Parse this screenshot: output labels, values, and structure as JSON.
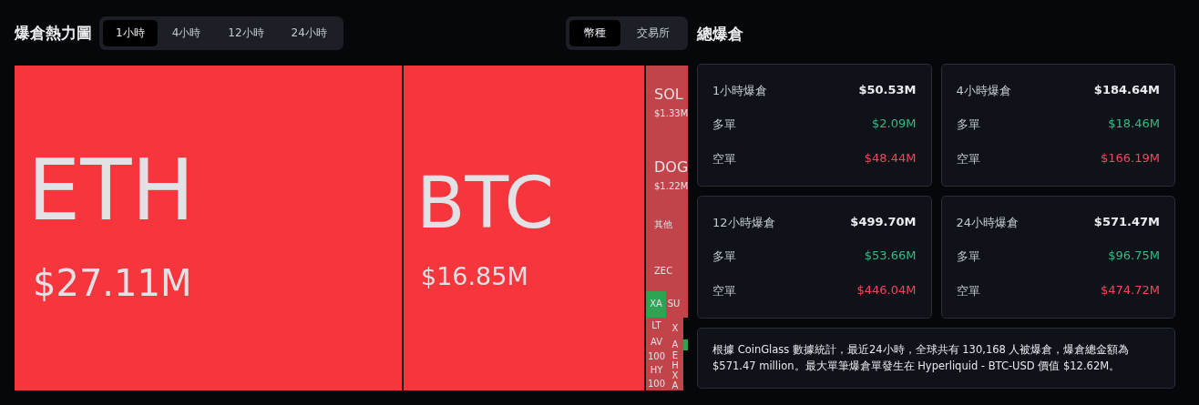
{
  "heatmap": {
    "title": "爆倉熱力圖",
    "time_tabs": [
      {
        "label": "1小時",
        "selected": true
      },
      {
        "label": "4小時",
        "selected": false
      },
      {
        "label": "12小時",
        "selected": false
      },
      {
        "label": "24小時",
        "selected": false
      }
    ],
    "group_tabs": [
      {
        "label": "幣種",
        "selected": true
      },
      {
        "label": "交易所",
        "selected": false
      }
    ],
    "tiles": [
      {
        "label": "ETH",
        "value": "$27.11M",
        "color": "#f6353c"
      },
      {
        "label": "BTC",
        "value": "$16.85M",
        "color": "#f6353c"
      },
      {
        "label": "SOL",
        "value": "$1.33M",
        "color": "#c0444a"
      },
      {
        "label": "DOG",
        "value": "$1.22M",
        "color": "#c0444a"
      },
      {
        "label": "其他",
        "color": "#c0444a"
      },
      {
        "label": "ZEC",
        "color": "#c0444a"
      },
      {
        "label": "XA",
        "color": "#2ea354"
      },
      {
        "label": "SU",
        "color": "#c0444a"
      },
      {
        "color": "#c0444a"
      },
      {
        "label": "LT",
        "color": "#c0444a"
      },
      {
        "label": "AV",
        "color": "#c0444a"
      },
      {
        "label": "100",
        "color": "#c0444a"
      },
      {
        "label": "HY",
        "color": "#c0444a"
      },
      {
        "label": "100",
        "color": "#c0444a"
      },
      {
        "label": "X",
        "color": "#c0444a"
      },
      {
        "label": "A",
        "color": "#c0444a"
      },
      {
        "label": "E",
        "color": "#c0444a"
      },
      {
        "label": "H",
        "color": "#c0444a"
      },
      {
        "label": "X",
        "color": "#c0444a"
      },
      {
        "label": "A",
        "color": "#c0444a"
      },
      {
        "color": "#2ea354"
      }
    ]
  },
  "total": {
    "title": "總爆倉",
    "cards": [
      {
        "label": "1小時爆倉",
        "total": "$50.53M",
        "long_label": "多單",
        "long": "$2.09M",
        "short_label": "空單",
        "short": "$48.44M"
      },
      {
        "label": "4小時爆倉",
        "total": "$184.64M",
        "long_label": "多單",
        "long": "$18.46M",
        "short_label": "空單",
        "short": "$166.19M"
      },
      {
        "label": "12小時爆倉",
        "total": "$499.70M",
        "long_label": "多單",
        "long": "$53.66M",
        "short_label": "空單",
        "short": "$446.04M"
      },
      {
        "label": "24小時爆倉",
        "total": "$571.47M",
        "long_label": "多單",
        "long": "$96.75M",
        "short_label": "空單",
        "short": "$474.72M"
      }
    ],
    "summary": "根據 CoinGlass 數據統計，最近24小時，全球共有 130,168 人被爆倉，爆倉總金額為 $571.47 million。最大單筆爆倉單發生在 Hyperliquid - BTC-USD 價值 $12.62M。"
  }
}
